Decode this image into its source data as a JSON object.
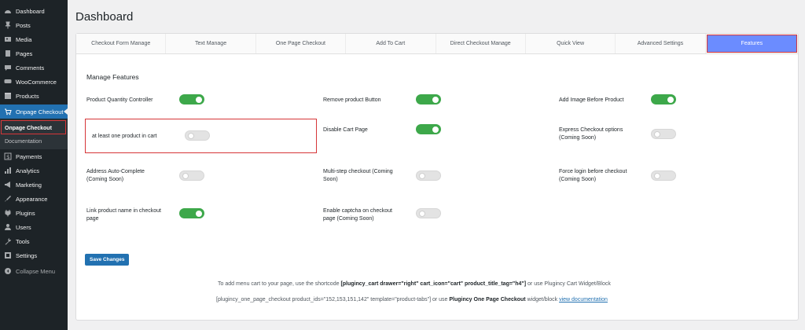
{
  "sidebar": {
    "items": [
      {
        "label": "Dashboard",
        "icon": "dashboard-icon"
      },
      {
        "label": "Posts",
        "icon": "pin-icon"
      },
      {
        "label": "Media",
        "icon": "media-icon"
      },
      {
        "label": "Pages",
        "icon": "page-icon"
      },
      {
        "label": "Comments",
        "icon": "comment-icon"
      },
      {
        "label": "WooCommerce",
        "icon": "woocommerce-icon"
      },
      {
        "label": "Products",
        "icon": "products-icon"
      },
      {
        "label": "Onpage Checkout",
        "icon": "cart-icon"
      },
      {
        "label": "Payments",
        "icon": "dollar-icon"
      },
      {
        "label": "Analytics",
        "icon": "analytics-icon"
      },
      {
        "label": "Marketing",
        "icon": "megaphone-icon"
      },
      {
        "label": "Appearance",
        "icon": "brush-icon"
      },
      {
        "label": "Plugins",
        "icon": "plugin-icon"
      },
      {
        "label": "Users",
        "icon": "users-icon"
      },
      {
        "label": "Tools",
        "icon": "wrench-icon"
      },
      {
        "label": "Settings",
        "icon": "settings-icon"
      },
      {
        "label": "Collapse Menu",
        "icon": "collapse-icon"
      }
    ],
    "submenu": [
      "Onpage Checkout",
      "Documentation"
    ]
  },
  "page": {
    "title": "Dashboard"
  },
  "tabs": [
    "Checkout Form Manage",
    "Text Manage",
    "One Page Checkout",
    "Add To Cart",
    "Direct Checkout Manage",
    "Quick View",
    "Advanced Settings",
    "Features"
  ],
  "features": {
    "title": "Manage Features",
    "items": [
      {
        "label": "Product Quantity Controller",
        "enabled": true
      },
      {
        "label": "Remove product Button",
        "enabled": true
      },
      {
        "label": "Add Image Before Product",
        "enabled": true
      },
      {
        "label": "at least one product in cart",
        "enabled": false
      },
      {
        "label": "Disable Cart Page",
        "enabled": true
      },
      {
        "label": "Express Checkout options (Coming Soon)",
        "enabled": false
      },
      {
        "label": "Address Auto-Complete (Coming Soon)",
        "enabled": false
      },
      {
        "label": "Multi-step checkout (Coming Soon)",
        "enabled": false
      },
      {
        "label": "Force login before checkout (Coming Soon)",
        "enabled": false
      },
      {
        "label": "Link product name in checkout page",
        "enabled": true
      },
      {
        "label": "Enable captcha on checkout page (Coming Soon)",
        "enabled": false
      }
    ]
  },
  "save_button": "Save Changes",
  "notes": {
    "line1_prefix": "To add menu cart to your page, use the shortcode",
    "line1_code": "[plugincy_cart drawer=\"right\" cart_icon=\"cart\" product_title_tag=\"h4\"]",
    "line1_suffix": "or use Plugincy Cart Widget/Block",
    "line2_prefix": "[plugincy_one_page_checkout product_ids=\"152,153,151,142\" template=\"product-tabs\"] or use",
    "line2_bold": "Plugincy One Page Checkout",
    "line2_mid": "widget/block",
    "line2_link": "view documentation"
  },
  "colors": {
    "accent": "#2271b1",
    "toggle_on": "#3da84a",
    "active_tab": "#6b8cff",
    "highlight": "#d63638"
  }
}
